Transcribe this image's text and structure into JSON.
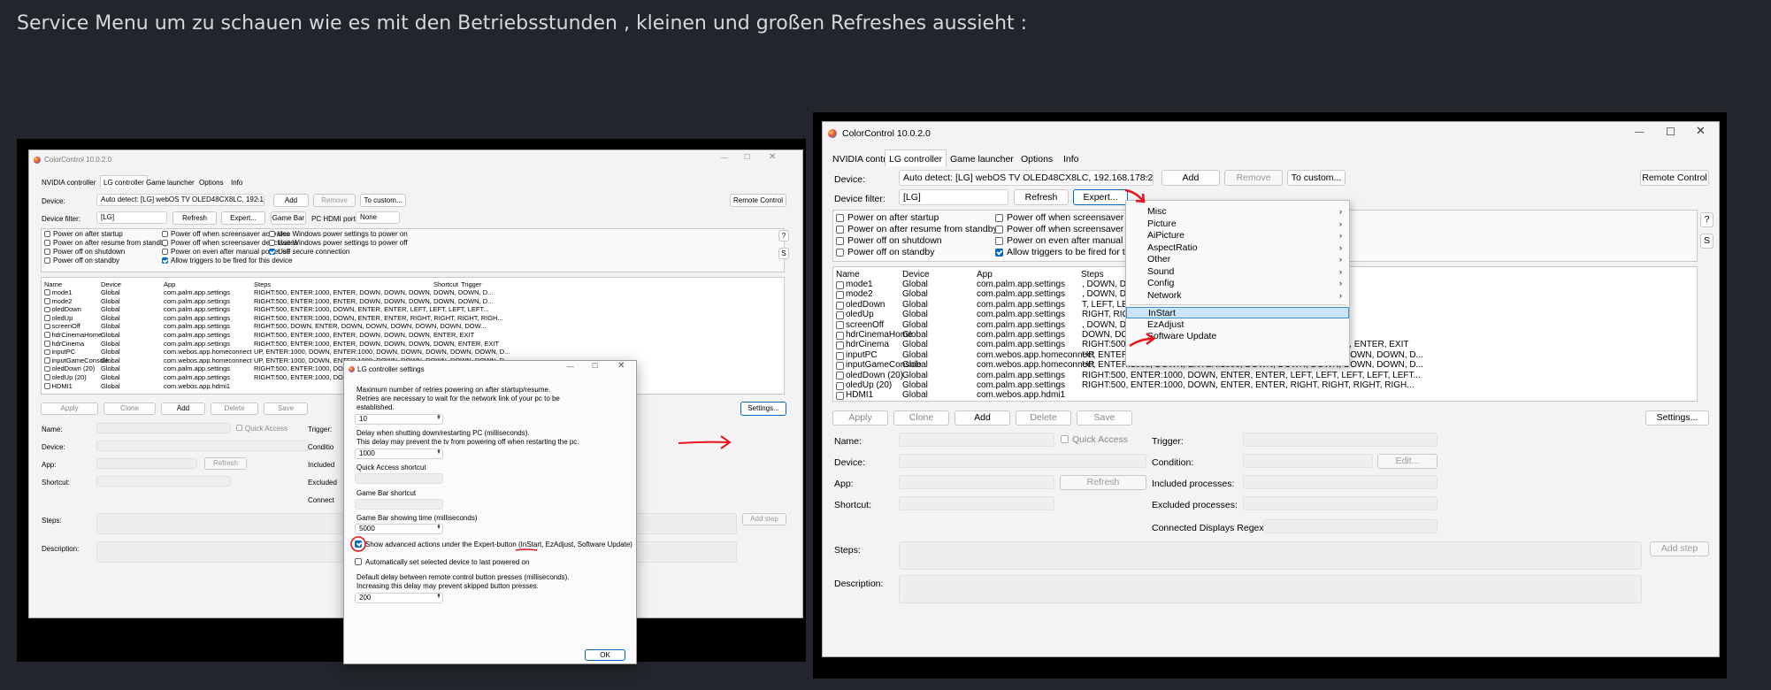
{
  "heading": "Service Menu um zu schauen wie es mit den Betriebsstunden , kleinen und großen Refreshes aussieht :",
  "app": {
    "title": "ColorControl 10.0.2.0",
    "tabs": [
      "NVIDIA controller",
      "LG controller",
      "Game launcher",
      "Options",
      "Info"
    ],
    "device_label": "Device:",
    "device_value": "Auto detect: [LG] webOS TV OLED48CX8LC, 192.168.178.22",
    "add": "Add",
    "remove": "Remove",
    "to_custom": "To custom...",
    "remote_control": "Remote Control",
    "filter_label": "Device filter:",
    "filter_value": "[LG]",
    "refresh": "Refresh",
    "expert": "Expert...",
    "game_bar": "Game Bar",
    "pc_hdmi_label": "PC HDMI port:",
    "pc_hdmi_value": "None",
    "options": [
      "Power on after startup",
      "Power on after resume from standby",
      "Power off on shutdown",
      "Power off on standby",
      "Power off when screensaver activates",
      "Power off when screensaver deactivates",
      "Power on even after manual power off",
      "Allow triggers to be fired for this device",
      "Use Windows power settings to power on",
      "Use Windows power settings to power off",
      "Use secure connection"
    ],
    "options_cut": [
      "Power off when screensaver activ",
      "Power off when screensaver deac",
      "Power on even after manual pow",
      "Allow triggers to be fired for this"
    ],
    "help_q": "?",
    "help_s": "S",
    "columns": [
      "Name",
      "Device",
      "App",
      "Steps",
      "Shortcut",
      "Trigger"
    ],
    "rows": [
      {
        "name": "mode1",
        "device": "Global",
        "app": "com.palm.app.settings",
        "steps": "RIGHT:500, ENTER:1000, ENTER, DOWN, DOWN, DOWN, DOWN, DOWN, D...",
        "steps_cut": ", DOWN, DOWN, D..."
      },
      {
        "name": "mode2",
        "device": "Global",
        "app": "com.palm.app.settings",
        "steps": "RIGHT:500, ENTER:1000, ENTER, DOWN, DOWN, DOWN, DOWN, DOWN, D...",
        "steps_cut": ", DOWN, DOWN, D..."
      },
      {
        "name": "oledDown",
        "device": "Global",
        "app": "com.palm.app.settings",
        "steps": "RIGHT:500, ENTER:1000, DOWN, ENTER, ENTER, LEFT, LEFT, LEFT, LEFT...",
        "steps_cut": "T, LEFT, LEFT, LEFT..."
      },
      {
        "name": "oledUp",
        "device": "Global",
        "app": "com.palm.app.settings",
        "steps": "RIGHT:500, ENTER:1000, DOWN, ENTER, ENTER, RIGHT, RIGHT, RIGHT, RIGH...",
        "steps_cut": "RIGHT, RIGHT, RIGH..."
      },
      {
        "name": "screenOff",
        "device": "Global",
        "app": "com.palm.app.settings",
        "steps": "RIGHT:500, DOWN, ENTER, DOWN, DOWN, DOWN, DOWN, DOWN, DOW...",
        "steps_cut": ", DOWN, DOWN, DOW..."
      },
      {
        "name": "hdrCinemaHome",
        "device": "Global",
        "app": "com.palm.app.settings",
        "steps": "RIGHT:500, ENTER:1000, ENTER, DOWN, DOWN, DOWN, ENTER, EXIT",
        "steps_cut": "DOWN, DOWN, ENTER, EXIT"
      },
      {
        "name": "hdrCinema",
        "device": "Global",
        "app": "com.palm.app.settings",
        "steps": "RIGHT:500, ENTER:1000, ENTER, DOWN, DOWN, DOWN, DOWN, ENTER, EXIT",
        "steps_cut": "RIGHT:500, ENTER:1000, ENTER, DOWN, DOWN, DOWN, DOWN, ENTER, EXIT"
      },
      {
        "name": "inputPC",
        "device": "Global",
        "app": "com.webos.app.homeconnect",
        "steps": "UP, ENTER:1000, DOWN, ENTER:1000, DOWN, DOWN, DOWN, DOWN, DOWN, D...",
        "steps_cut": "UP, ENTER:1000, DOWN, ENTER:1000, DOWN, DOWN, DOWN, DOWN, DOWN, D..."
      },
      {
        "name": "inputGameConsole",
        "device": "Global",
        "app": "com.webos.app.homeconnect",
        "steps": "UP, ENTER:1000, DOWN, ENTER:1000, DOWN, DOWN, DOWN, DOWN, DOWN, D...",
        "steps_cut": "UP, ENTER:1000, DOWN, ENTER:1000, DOWN, DOWN, DOWN, DOWN, DOWN, D..."
      },
      {
        "name": "oledDown (20)",
        "device": "Global",
        "app": "com.palm.app.settings",
        "steps": "RIGHT:500, ENTER:1000, DOWN, ENTER, ENTER, LEFT, LEFT, LEFT, LEFT, LEFT...",
        "steps_cut": "RIGHT:500, ENTER:1000, DOWN, ENTER, ENTER, LEFT, LEFT, LEFT, LEFT, LEFT..."
      },
      {
        "name": "oledUp (20)",
        "device": "Global",
        "app": "com.palm.app.settings",
        "steps": "RIGHT:500, ENTER:1000, DOWN, ENTER, ENTER, RIGHT, RIGHT, RIGHT, RIGH...",
        "steps_cut": "RIGHT:500, ENTER:1000, DOWN, ENTER, ENTER, RIGHT, RIGHT, RIGHT, RIGH..."
      },
      {
        "name": "HDMI1",
        "device": "Global",
        "app": "com.webos.app.hdmi1",
        "steps": "",
        "steps_cut": ""
      }
    ],
    "apply": "Apply",
    "clone": "Clone",
    "delete": "Delete",
    "save": "Save",
    "settings": "Settings...",
    "name_label": "Name:",
    "quick_access": "Quick Access",
    "trigger_label": "Trigger:",
    "device_label2": "Device:",
    "condition_label": "Condition:",
    "edit": "Edit...",
    "app_label": "App:",
    "included_label": "Included processes:",
    "excluded_label": "Excluded processes:",
    "shortcut_label": "Shortcut:",
    "connected_label": "Connected Displays Regex:",
    "steps_label": "Steps:",
    "add_step": "Add step",
    "description_label": "Description:"
  },
  "cut": {
    "condition": "Conditio",
    "included": "Included",
    "excluded": "Excluded",
    "connected": "Connect"
  },
  "menu": {
    "items": [
      "Misc",
      "Picture",
      "AiPicture",
      "AspectRatio",
      "Other",
      "Sound",
      "Config",
      "Network",
      "InStart",
      "EzAdjust",
      "Software Update"
    ],
    "submenu": [
      true,
      true,
      true,
      true,
      true,
      true,
      true,
      true,
      false,
      false,
      false
    ],
    "highlight": "InStart",
    "arrow": "›"
  },
  "dialog": {
    "title": "LG controller settings",
    "retries_text1": "Maximum number of retries powering on after startup/resume.",
    "retries_text2": "Retries are necessary to wait for the network link of your pc to be",
    "retries_text3": "established.",
    "retries_value": "10",
    "shutdown_text1": "Delay when shutting down/restarting PC (milliseconds).",
    "shutdown_text2": "This delay may prevent the tv from powering off when restarting the pc.",
    "shutdown_value": "1000",
    "quick_access": "Quick Access shortcut",
    "game_bar": "Game Bar shortcut",
    "game_bar_time": "Game Bar showing time (milliseconds)",
    "game_bar_time_value": "5000",
    "show_advanced": "Show advanced actions under the Expert-button (InStart, EzAdjust, Software Update)",
    "auto_set": "Automatically set selected device to last powered on",
    "delay_text1": "Default delay between remote control button presses (milliseconds).",
    "delay_text2": "Increasing this delay may prevent skipped button presses.",
    "delay_value": "200",
    "ok": "OK"
  },
  "colors": {
    "accent": "#0067c0",
    "annotation": "#e8141b",
    "page_bg": "#22252b",
    "heading": "#d6d8dc"
  }
}
